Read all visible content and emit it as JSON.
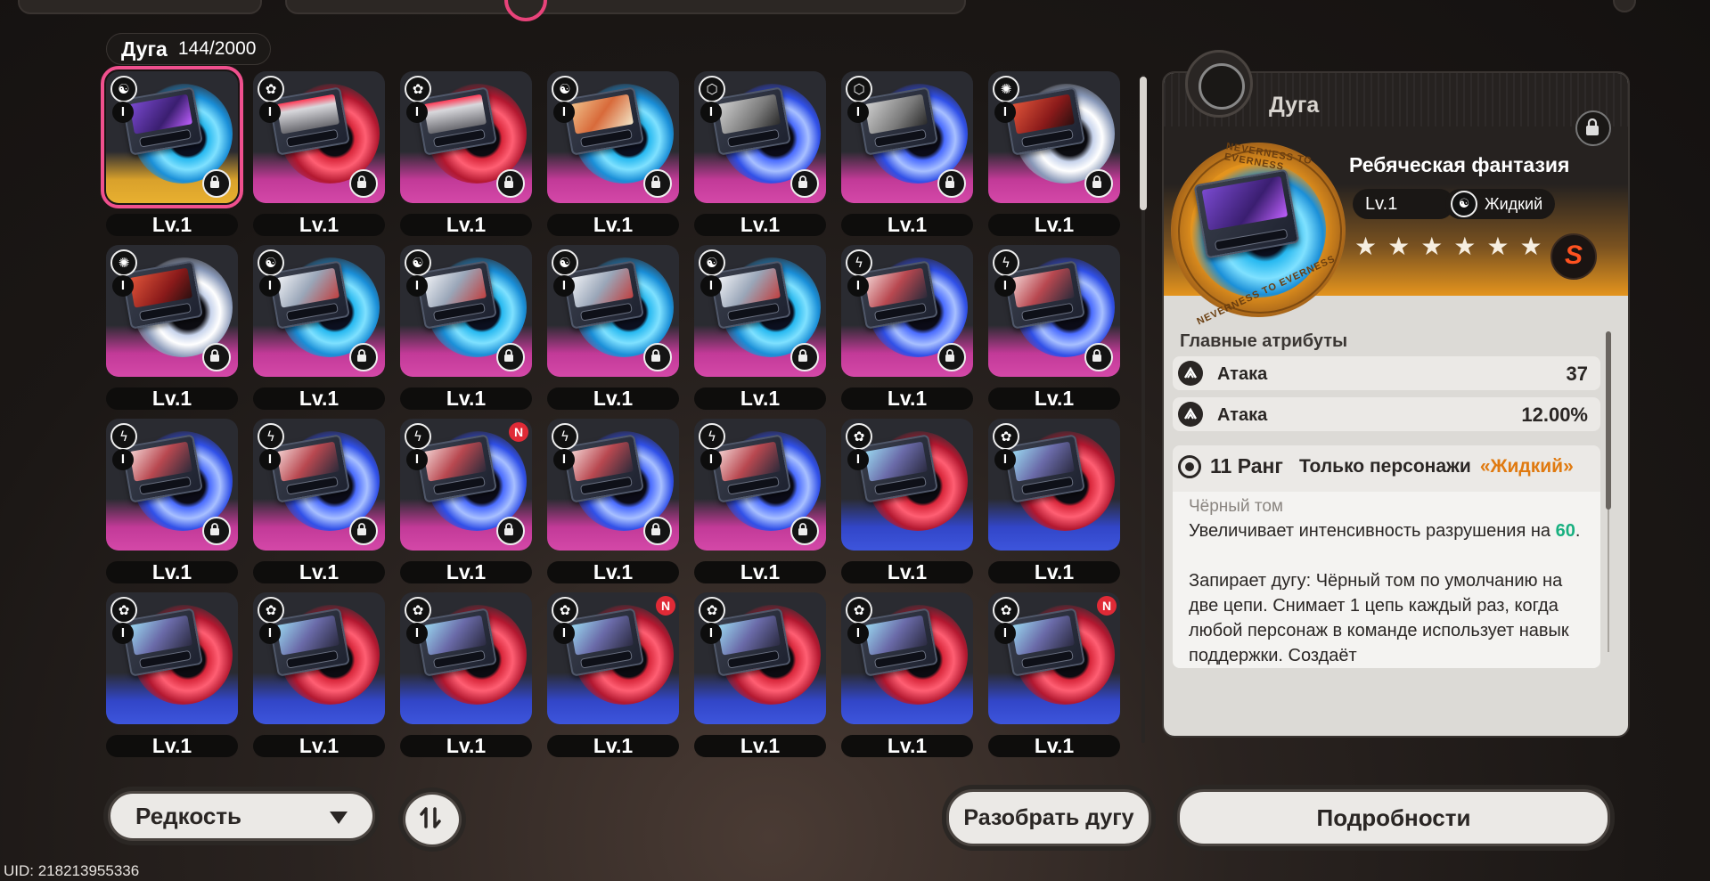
{
  "inventory": {
    "title": "Дуга",
    "count": "144/2000"
  },
  "grid": [
    {
      "elem": "☯",
      "art": "a-purple",
      "disc": "d-cyan",
      "rarity": "r-gold",
      "tier": "I",
      "locked": true,
      "new": false,
      "selected": true,
      "level": "Lv.1"
    },
    {
      "elem": "✿",
      "art": "a-rain",
      "disc": "d-red",
      "rarity": "r-pink",
      "tier": "I",
      "locked": true,
      "new": false,
      "selected": false,
      "level": "Lv.1"
    },
    {
      "elem": "✿",
      "art": "a-rain",
      "disc": "d-red",
      "rarity": "r-pink",
      "tier": "I",
      "locked": true,
      "new": false,
      "selected": false,
      "level": "Lv.1"
    },
    {
      "elem": "☯",
      "art": "a-comic",
      "disc": "d-cyan",
      "rarity": "r-pink",
      "tier": "I",
      "locked": true,
      "new": false,
      "selected": false,
      "level": "Lv.1"
    },
    {
      "elem": "⬡",
      "art": "a-gray",
      "disc": "d-elec",
      "rarity": "r-pink",
      "tier": "I",
      "locked": true,
      "new": false,
      "selected": false,
      "level": "Lv.1"
    },
    {
      "elem": "⬡",
      "art": "a-gray",
      "disc": "d-elec",
      "rarity": "r-pink",
      "tier": "I",
      "locked": true,
      "new": false,
      "selected": false,
      "level": "Lv.1"
    },
    {
      "elem": "✺",
      "art": "a-devil",
      "disc": "d-white",
      "rarity": "r-pink",
      "tier": "I",
      "locked": true,
      "new": false,
      "selected": false,
      "level": "Lv.1"
    },
    {
      "elem": "✺",
      "art": "a-devil",
      "disc": "d-white",
      "rarity": "r-pink",
      "tier": "I",
      "locked": true,
      "new": false,
      "selected": false,
      "level": "Lv.1"
    },
    {
      "elem": "☯",
      "art": "a-shark",
      "disc": "d-cyan",
      "rarity": "r-pink",
      "tier": "I",
      "locked": true,
      "new": false,
      "selected": false,
      "level": "Lv.1"
    },
    {
      "elem": "☯",
      "art": "a-shark",
      "disc": "d-cyan",
      "rarity": "r-pink",
      "tier": "I",
      "locked": true,
      "new": false,
      "selected": false,
      "level": "Lv.1"
    },
    {
      "elem": "☯",
      "art": "a-shark",
      "disc": "d-cyan",
      "rarity": "r-pink",
      "tier": "I",
      "locked": true,
      "new": false,
      "selected": false,
      "level": "Lv.1"
    },
    {
      "elem": "☯",
      "art": "a-shark",
      "disc": "d-cyan",
      "rarity": "r-pink",
      "tier": "I",
      "locked": true,
      "new": false,
      "selected": false,
      "level": "Lv.1"
    },
    {
      "elem": "ϟ",
      "art": "a-storm",
      "disc": "d-elec",
      "rarity": "r-pink",
      "tier": "I",
      "locked": true,
      "new": false,
      "selected": false,
      "level": "Lv.1"
    },
    {
      "elem": "ϟ",
      "art": "a-storm",
      "disc": "d-elec",
      "rarity": "r-pink",
      "tier": "I",
      "locked": true,
      "new": false,
      "selected": false,
      "level": "Lv.1"
    },
    {
      "elem": "ϟ",
      "art": "a-storm",
      "disc": "d-elec",
      "rarity": "r-pink",
      "tier": "I",
      "locked": true,
      "new": false,
      "selected": false,
      "level": "Lv.1"
    },
    {
      "elem": "ϟ",
      "art": "a-storm",
      "disc": "d-elec",
      "rarity": "r-pink",
      "tier": "I",
      "locked": true,
      "new": false,
      "selected": false,
      "level": "Lv.1"
    },
    {
      "elem": "ϟ",
      "art": "a-storm",
      "disc": "d-elec",
      "rarity": "r-pink",
      "tier": "I",
      "locked": true,
      "new": true,
      "selected": false,
      "level": "Lv.1"
    },
    {
      "elem": "ϟ",
      "art": "a-storm",
      "disc": "d-elec",
      "rarity": "r-pink",
      "tier": "I",
      "locked": true,
      "new": false,
      "selected": false,
      "level": "Lv.1"
    },
    {
      "elem": "ϟ",
      "art": "a-storm",
      "disc": "d-elec",
      "rarity": "r-pink",
      "tier": "I",
      "locked": true,
      "new": false,
      "selected": false,
      "level": "Lv.1"
    },
    {
      "elem": "✿",
      "art": "a-kitty",
      "disc": "d-red",
      "rarity": "r-blue",
      "tier": "I",
      "locked": false,
      "new": false,
      "selected": false,
      "level": "Lv.1"
    },
    {
      "elem": "✿",
      "art": "a-kitty",
      "disc": "d-red",
      "rarity": "r-blue",
      "tier": "I",
      "locked": false,
      "new": false,
      "selected": false,
      "level": "Lv.1"
    },
    {
      "elem": "✿",
      "art": "a-kitty",
      "disc": "d-red",
      "rarity": "r-blue",
      "tier": "I",
      "locked": false,
      "new": false,
      "selected": false,
      "level": "Lv.1"
    },
    {
      "elem": "✿",
      "art": "a-kitty",
      "disc": "d-red",
      "rarity": "r-blue",
      "tier": "I",
      "locked": false,
      "new": false,
      "selected": false,
      "level": "Lv.1"
    },
    {
      "elem": "✿",
      "art": "a-kitty",
      "disc": "d-red",
      "rarity": "r-blue",
      "tier": "I",
      "locked": false,
      "new": false,
      "selected": false,
      "level": "Lv.1"
    },
    {
      "elem": "✿",
      "art": "a-kitty",
      "disc": "d-red",
      "rarity": "r-blue",
      "tier": "I",
      "locked": false,
      "new": true,
      "selected": false,
      "level": "Lv.1"
    },
    {
      "elem": "✿",
      "art": "a-kitty",
      "disc": "d-red",
      "rarity": "r-blue",
      "tier": "I",
      "locked": false,
      "new": false,
      "selected": false,
      "level": "Lv.1"
    },
    {
      "elem": "✿",
      "art": "a-kitty",
      "disc": "d-red",
      "rarity": "r-blue",
      "tier": "I",
      "locked": false,
      "new": false,
      "selected": false,
      "level": "Lv.1"
    },
    {
      "elem": "✿",
      "art": "a-kitty",
      "disc": "d-red",
      "rarity": "r-blue",
      "tier": "I",
      "locked": false,
      "new": true,
      "selected": false,
      "level": "Lv.1"
    }
  ],
  "detail": {
    "category": "Дуга",
    "name": "Ребяческая фантазия",
    "level": "Lv.1",
    "element": "Жидкий",
    "element_icon": "☯",
    "stars": "★★★★★★",
    "rank_letter": "S",
    "ring_text_top": "NEVERNESS TO EVERNESS",
    "ring_text_bottom": "NEVERNESS TO EVERNESS",
    "main_attrs_title": "Главные атрибуты",
    "attrs": [
      {
        "name": "Атака",
        "value": "37"
      },
      {
        "name": "Атака",
        "value": "12.00%"
      }
    ],
    "skill": {
      "rank": "11 Ранг",
      "only_for": "Только персонажи",
      "character": "«Жидкий»",
      "subtitle": "Чёрный том",
      "line1_a": "Увеличивает интенсивность разрушения на ",
      "line1_num": "60",
      "line1_b": ".",
      "line2": "Запирает дугу: Чёрный том по умолчанию на две цепи. Снимает 1 цепь каждый раз, когда любой персонаж в команде использует навык поддержки. Создаёт"
    }
  },
  "buttons": {
    "sort_label": "Редкость",
    "dismantle_label": "Разобрать дугу",
    "details_label": "Подробности"
  },
  "uid": "UID: 218213955336",
  "colors": {
    "accent_pink": "#f0508e",
    "gold": "#e4941e",
    "number_green": "#18b080",
    "char_orange": "#e07a10"
  }
}
